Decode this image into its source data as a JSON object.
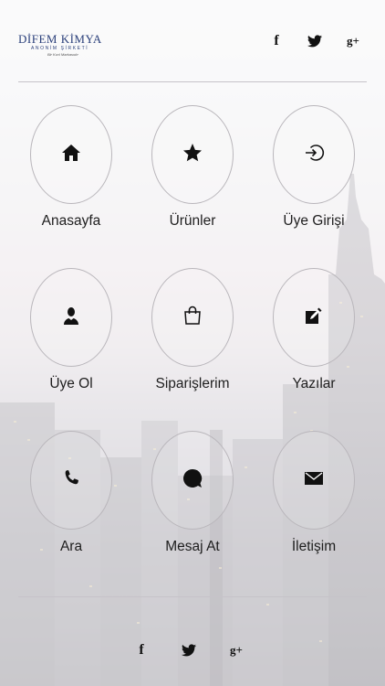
{
  "header": {
    "logo_main": "DİFEM KİMYA",
    "logo_sub": "ANONİM ŞİRKETİ",
    "logo_tag": "Bir Kızıl Markasıdır"
  },
  "social_icons": [
    "facebook-icon",
    "twitter-icon",
    "google-plus-icon"
  ],
  "social_glyphs": {
    "facebook": "f",
    "google_plus": "g+"
  },
  "menu": [
    {
      "label": "Anasayfa",
      "icon": "home-icon"
    },
    {
      "label": "Ürünler",
      "icon": "star-icon"
    },
    {
      "label": "Üye Girişi",
      "icon": "sign-in-icon"
    },
    {
      "label": "Üye Ol",
      "icon": "user-icon"
    },
    {
      "label": "Siparişlerim",
      "icon": "shopping-bag-icon"
    },
    {
      "label": "Yazılar",
      "icon": "edit-icon"
    },
    {
      "label": "Ara",
      "icon": "phone-icon"
    },
    {
      "label": "Mesaj At",
      "icon": "chat-bubble-icon"
    },
    {
      "label": "İletişim",
      "icon": "envelope-icon"
    }
  ],
  "colors": {
    "logo": "#2a3f7a",
    "icon": "#111111",
    "circle_border": "#b9b6bb",
    "divider": "#c6c3c9"
  }
}
